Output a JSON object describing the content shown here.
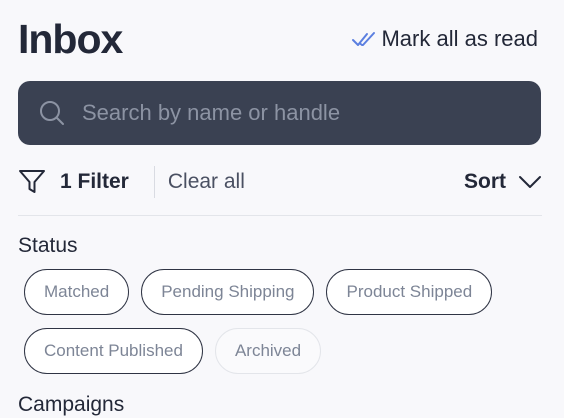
{
  "header": {
    "title": "Inbox",
    "mark_all_read": "Mark all as read",
    "mark_all_icon": "double-check-icon",
    "accent_color": "#5b7fe0"
  },
  "search": {
    "placeholder": "Search by name or handle",
    "value": "",
    "icon": "search-icon"
  },
  "filters": {
    "filter_label": "1 Filter",
    "filter_icon": "funnel-icon",
    "clear_label": "Clear all",
    "sort_label": "Sort",
    "sort_icon": "chevron-down-icon"
  },
  "status": {
    "label": "Status",
    "chips": [
      {
        "label": "Matched",
        "state": "default"
      },
      {
        "label": "Pending Shipping",
        "state": "default"
      },
      {
        "label": "Product Shipped",
        "state": "default"
      },
      {
        "label": "Content Published",
        "state": "default"
      },
      {
        "label": "Archived",
        "state": "faded"
      }
    ]
  },
  "campaigns": {
    "label": "Campaigns"
  }
}
